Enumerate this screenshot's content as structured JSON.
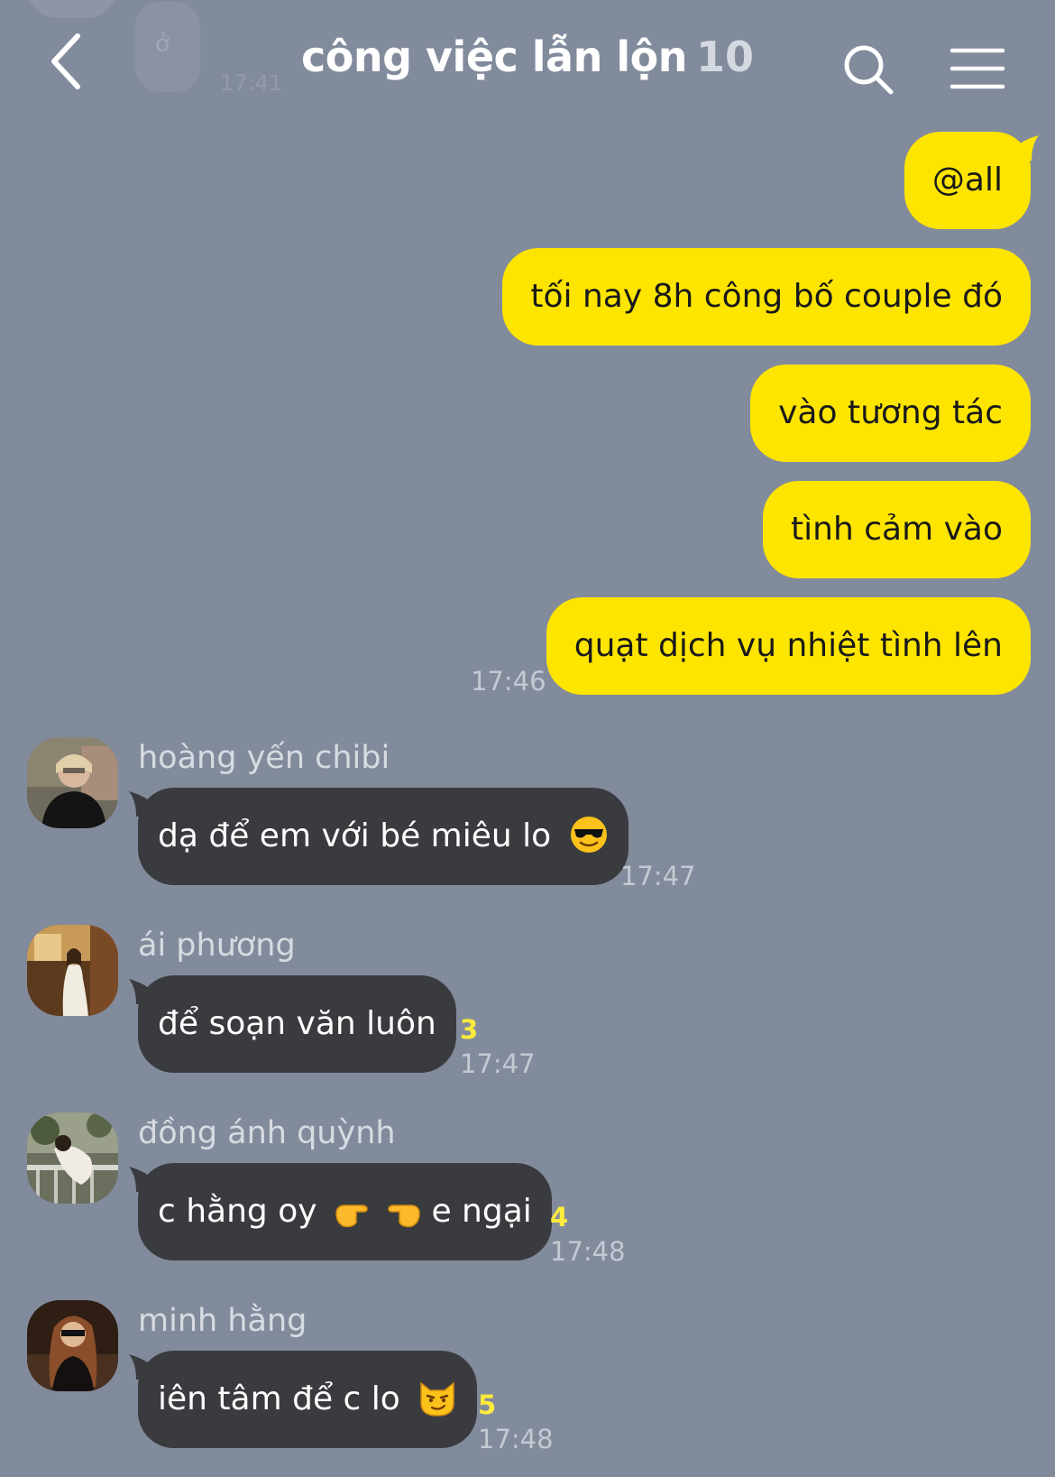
{
  "header": {
    "title": "công việc lẫn lộn",
    "member_count": "10",
    "ghost_text": "ở",
    "ghost_time": "17:41"
  },
  "sent_messages": [
    {
      "text": "@all"
    },
    {
      "text": "tối nay 8h công bố couple đó"
    },
    {
      "text": "vào tương tác"
    },
    {
      "text": "tình cảm vào"
    },
    {
      "text": "quạt dịch vụ nhiệt tình lên"
    }
  ],
  "sent_time": "17:46",
  "received_messages": [
    {
      "sender": "hoàng yến chibi",
      "text": "dạ để em với bé miêu lo",
      "emoji": "sunglasses-emoji",
      "unread": "",
      "time": "17:47"
    },
    {
      "sender": "ái phương",
      "text": "để soạn văn luôn",
      "unread": "3",
      "time": "17:47"
    },
    {
      "sender": "đồng ánh quỳnh",
      "text_before": "c hằng oy",
      "emoji": "pointing-hands-emoji",
      "text_after": "e ngại",
      "unread": "4",
      "time": "17:48"
    },
    {
      "sender": "minh hằng",
      "text": "iên tâm để c lo",
      "emoji": "smirking-cat-emoji",
      "unread": "5",
      "time": "17:48"
    }
  ],
  "colors": {
    "background": "#828b9c",
    "sent_bubble": "#fee500",
    "received_bubble": "#3a3b3f",
    "unread": "#ffeb3b"
  }
}
